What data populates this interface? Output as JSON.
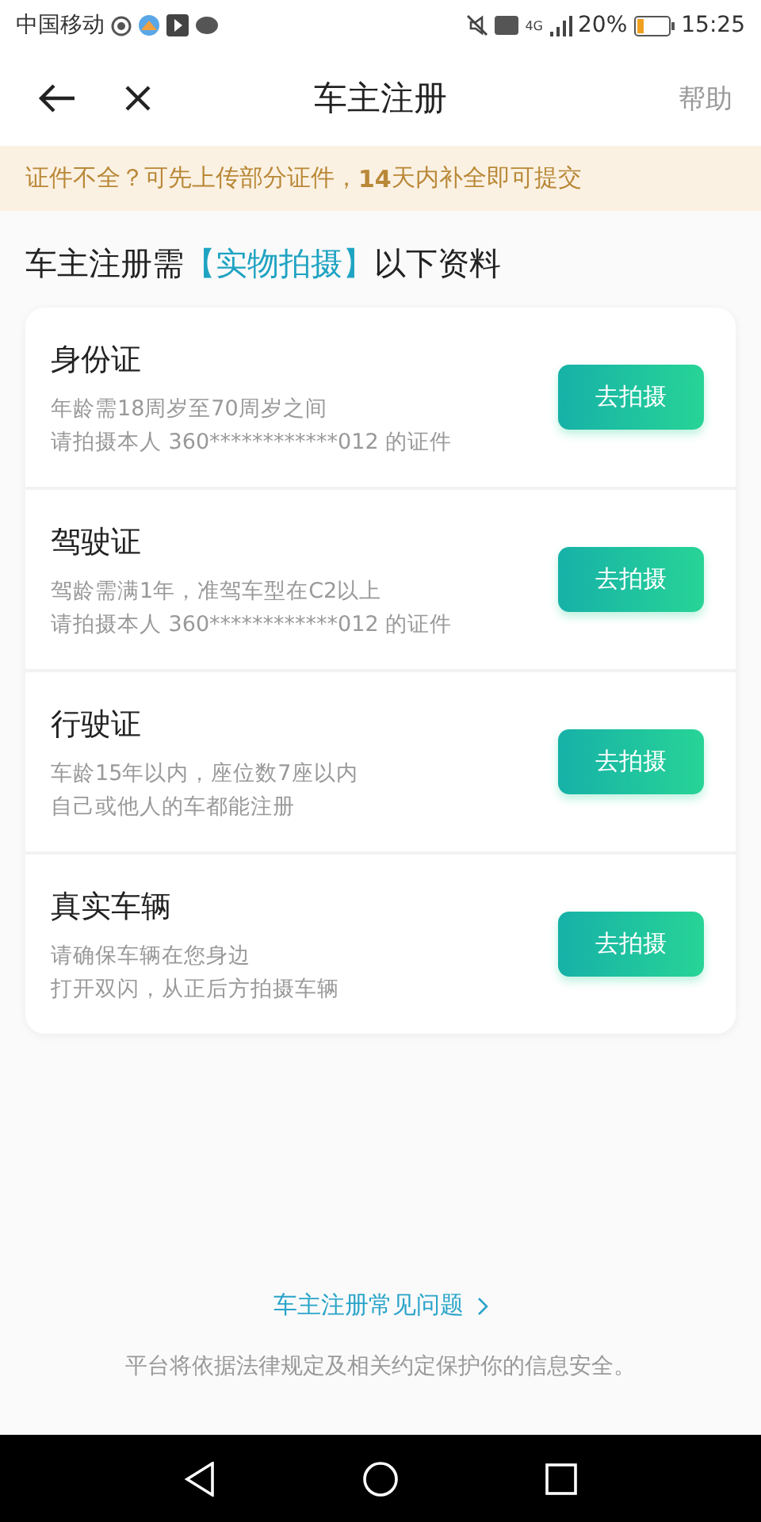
{
  "status_bar": {
    "carrier": "中国移动",
    "network": "4G",
    "battery": "20%",
    "time": "15:25"
  },
  "header": {
    "title": "车主注册",
    "help": "帮助"
  },
  "notice": "证件不全？可先上传部分证件，**14**天内补全即可提交",
  "heading": {
    "prefix": "车主注册需",
    "highlight": "【实物拍摄】",
    "suffix": "以下资料"
  },
  "items": [
    {
      "title": "身份证",
      "lines": [
        "年龄需18周岁至70周岁之间",
        "请拍摄本人 360************012 的证件"
      ],
      "button": "去拍摄"
    },
    {
      "title": "驾驶证",
      "lines": [
        "驾龄需满1年，准驾车型在C2以上",
        "请拍摄本人 360************012 的证件"
      ],
      "button": "去拍摄"
    },
    {
      "title": "行驶证",
      "lines": [
        "车龄15年以内，座位数7座以内",
        "自己或他人的车都能注册"
      ],
      "button": "去拍摄"
    },
    {
      "title": "真实车辆",
      "lines": [
        "请确保车辆在您身边",
        "打开双闪，从正后方拍摄车辆"
      ],
      "button": "去拍摄"
    }
  ],
  "faq_link": "车主注册常见问题",
  "footer": "平台将依据法律规定及相关约定保护你的信息安全。"
}
